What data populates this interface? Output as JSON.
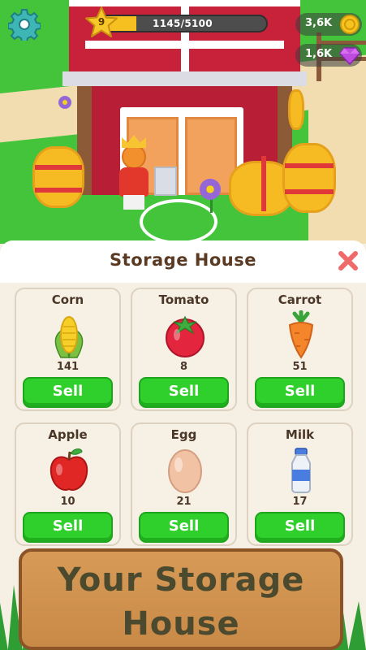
{
  "hud": {
    "level": "9",
    "xp_text": "1145/5100",
    "xp_progress": 0.2245,
    "coins": "3,6K",
    "gems": "1,6K",
    "icons": {
      "settings": "gear-icon",
      "coin": "coin-icon",
      "gem": "gem-icon",
      "level": "star-icon"
    }
  },
  "panel": {
    "title": "Storage House",
    "close_icon": "close-icon",
    "items": [
      {
        "name": "Corn",
        "count": "141",
        "sell_label": "Sell",
        "icon": "corn-icon"
      },
      {
        "name": "Tomato",
        "count": "8",
        "sell_label": "Sell",
        "icon": "tomato-icon"
      },
      {
        "name": "Carrot",
        "count": "51",
        "sell_label": "Sell",
        "icon": "carrot-icon"
      },
      {
        "name": "Apple",
        "count": "10",
        "sell_label": "Sell",
        "icon": "apple-icon"
      },
      {
        "name": "Egg",
        "count": "21",
        "sell_label": "Sell",
        "icon": "egg-icon"
      },
      {
        "name": "Milk",
        "count": "17",
        "sell_label": "Sell",
        "icon": "milk-icon"
      }
    ]
  },
  "banner": {
    "line1": "Your Storage",
    "line2": "House"
  },
  "colors": {
    "sell_green": "#2fcf2c",
    "barn_red": "#b81e35",
    "panel_bg": "#f6efe3",
    "title_brown": "#5a3a22"
  }
}
